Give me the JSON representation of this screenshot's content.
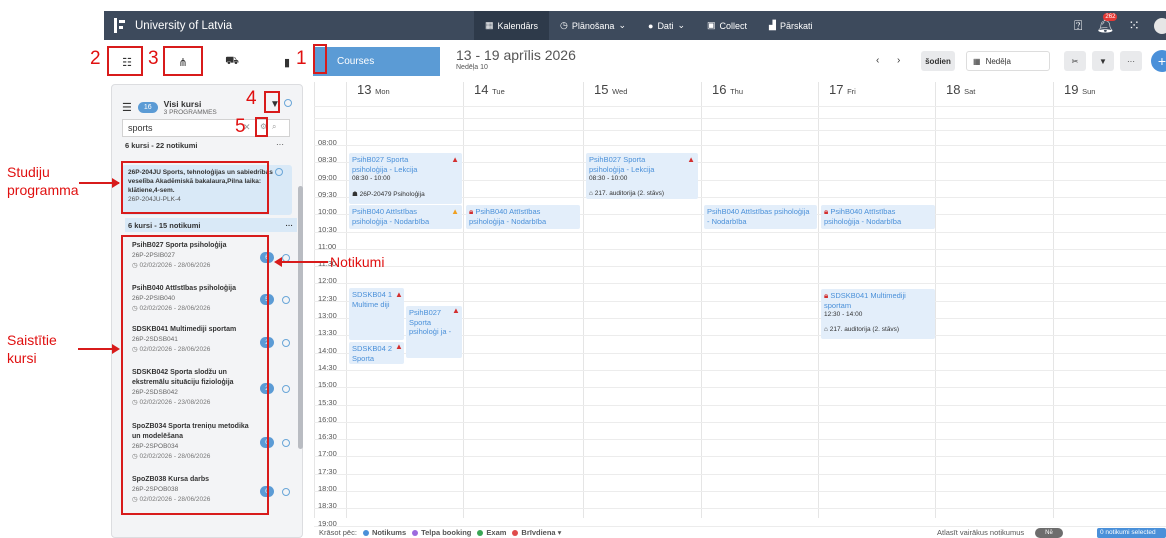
{
  "topbar": {
    "brand": "University of Latvia",
    "nav": [
      {
        "label": "Kalendārs",
        "icon": "calendar-icon",
        "caret": ""
      },
      {
        "label": "Plānošana",
        "icon": "clock-icon",
        "caret": "⌄"
      },
      {
        "label": "Dati",
        "icon": "database-icon",
        "caret": "⌄"
      },
      {
        "label": "Collect",
        "icon": "collect-icon",
        "caret": ""
      },
      {
        "label": "Pārskati",
        "icon": "chart-icon",
        "caret": ""
      }
    ],
    "notif_count": "262"
  },
  "sidebar": {
    "count": "16",
    "title": "Visi kursi",
    "subtitle": "3 PROGRAMMES",
    "search_value": "sports",
    "group_top": "6 kursi - 22 notikumi",
    "program": {
      "name": "26P-204JU Sports, tehnoloģijas un sabiedrības veselība Akadēmiskā bakalaura,Pilna laika: klātiene,4-sem.",
      "code": "26P-204JU-PLK-4"
    },
    "group_mid": "6 kursi - 15 notikumi",
    "courses": [
      {
        "name": "PsihB027 Sporta psiholoģija",
        "code": "26P-2PSIB027",
        "dates": "02/02/2026 - 28/06/2026",
        "count": "6"
      },
      {
        "name": "PsihB040 Attīstības psiholoģija",
        "code": "26P-2PSIB040",
        "dates": "02/02/2026 - 28/06/2026",
        "count": "5"
      },
      {
        "name": "SDSKB041 Multimediji sportam",
        "code": "26P-2SDSB041",
        "dates": "02/02/2026 - 28/06/2026",
        "count": "2"
      },
      {
        "name": "SDSKB042 Sporta slodžu un ekstremālu situāciju fizioloģija",
        "code": "26P-2SDSB042",
        "dates": "02/02/2026 - 23/08/2026",
        "count": "2"
      },
      {
        "name": "SpoZB034 Sporta treniņu metodika un modelēšana",
        "code": "26P-2SPOB034",
        "dates": "02/02/2026 - 28/06/2026",
        "count": "0"
      },
      {
        "name": "SpoZB038 Kursa darbs",
        "code": "26P-2SPOB038",
        "dates": "02/02/2026 - 28/06/2026",
        "count": "0"
      }
    ]
  },
  "header": {
    "courses_tab": "Courses",
    "week_title": "13 - 19 aprīlis 2026",
    "week_sub": "Nedēļa 10",
    "today": "šodien",
    "view": "Nedēļa"
  },
  "days": [
    {
      "num": "13",
      "name": "Mon"
    },
    {
      "num": "14",
      "name": "Tue"
    },
    {
      "num": "15",
      "name": "Wed"
    },
    {
      "num": "16",
      "name": "Thu"
    },
    {
      "num": "17",
      "name": "Fri"
    },
    {
      "num": "18",
      "name": "Sat"
    },
    {
      "num": "19",
      "name": "Sun"
    }
  ],
  "times": [
    "08:00",
    "08:30",
    "09:00",
    "09:30",
    "10:00",
    "10:30",
    "11:00",
    "11:30",
    "12:00",
    "12:30",
    "13:00",
    "13:30",
    "14:00",
    "14:30",
    "15:00",
    "15:30",
    "16:00",
    "16:30",
    "17:00",
    "17:30",
    "18:00",
    "18:30",
    "19:00"
  ],
  "events": {
    "e1": {
      "title": "PsihB027 Sporta psiholoģija - Lekcija",
      "time": "08:30 - 10:00",
      "group": "26P-20479 Psiholoģija"
    },
    "e2": {
      "title": "PsihB027 Sporta psiholoģija - Lekcija",
      "time": "08:30 - 10:00",
      "room": "217. auditorija (2. stāvs)"
    },
    "e3": {
      "title": "PsihB040 Attīstības psiholoģija - Nodarbība"
    },
    "e4": {
      "title": "PsihB040 Attīstības psiholoģija - Nodarbība"
    },
    "e5": {
      "title": "PsihB040 Attīstības psiholoģija - Nodarbība"
    },
    "e6": {
      "title": "PsihB040 Attīstības psiholoģija - Nodarbība"
    },
    "e7": {
      "title": "SDSKB04 1 Multime diji"
    },
    "e8": {
      "title": "PsihB027 Sporta psiholoģi ja -"
    },
    "e9": {
      "title": "SDSKB04 2 Sporta"
    },
    "e10": {
      "title": "SDSKB041 Multimediji sportam",
      "time": "12:30 - 14:00",
      "room": "217. auditorija (2. stāvs)"
    }
  },
  "footer": {
    "label": "Krāsot pēc:",
    "legend": [
      {
        "label": "Notikums",
        "color": "#4a90d9"
      },
      {
        "label": "Telpa booking",
        "color": "#9c6ade"
      },
      {
        "label": "Exam",
        "color": "#3aa655"
      },
      {
        "label": "Brīvdiena",
        "color": "#e04b4b"
      }
    ],
    "multi_label": "Atlasīt vairākus notikumus",
    "toggle": "Nē",
    "selected": "0 notikumi selected"
  },
  "annotations": {
    "n1": "1",
    "n2": "2",
    "n3": "3",
    "n4": "4",
    "n5": "5",
    "studiju": "Studiju programma",
    "notikumi": "Notikumi",
    "saistitie": "Saistītie kursi"
  },
  "colors": {
    "annotation": "#e01010",
    "accent": "#5b9bd5",
    "topbar": "#3d4a5c"
  }
}
